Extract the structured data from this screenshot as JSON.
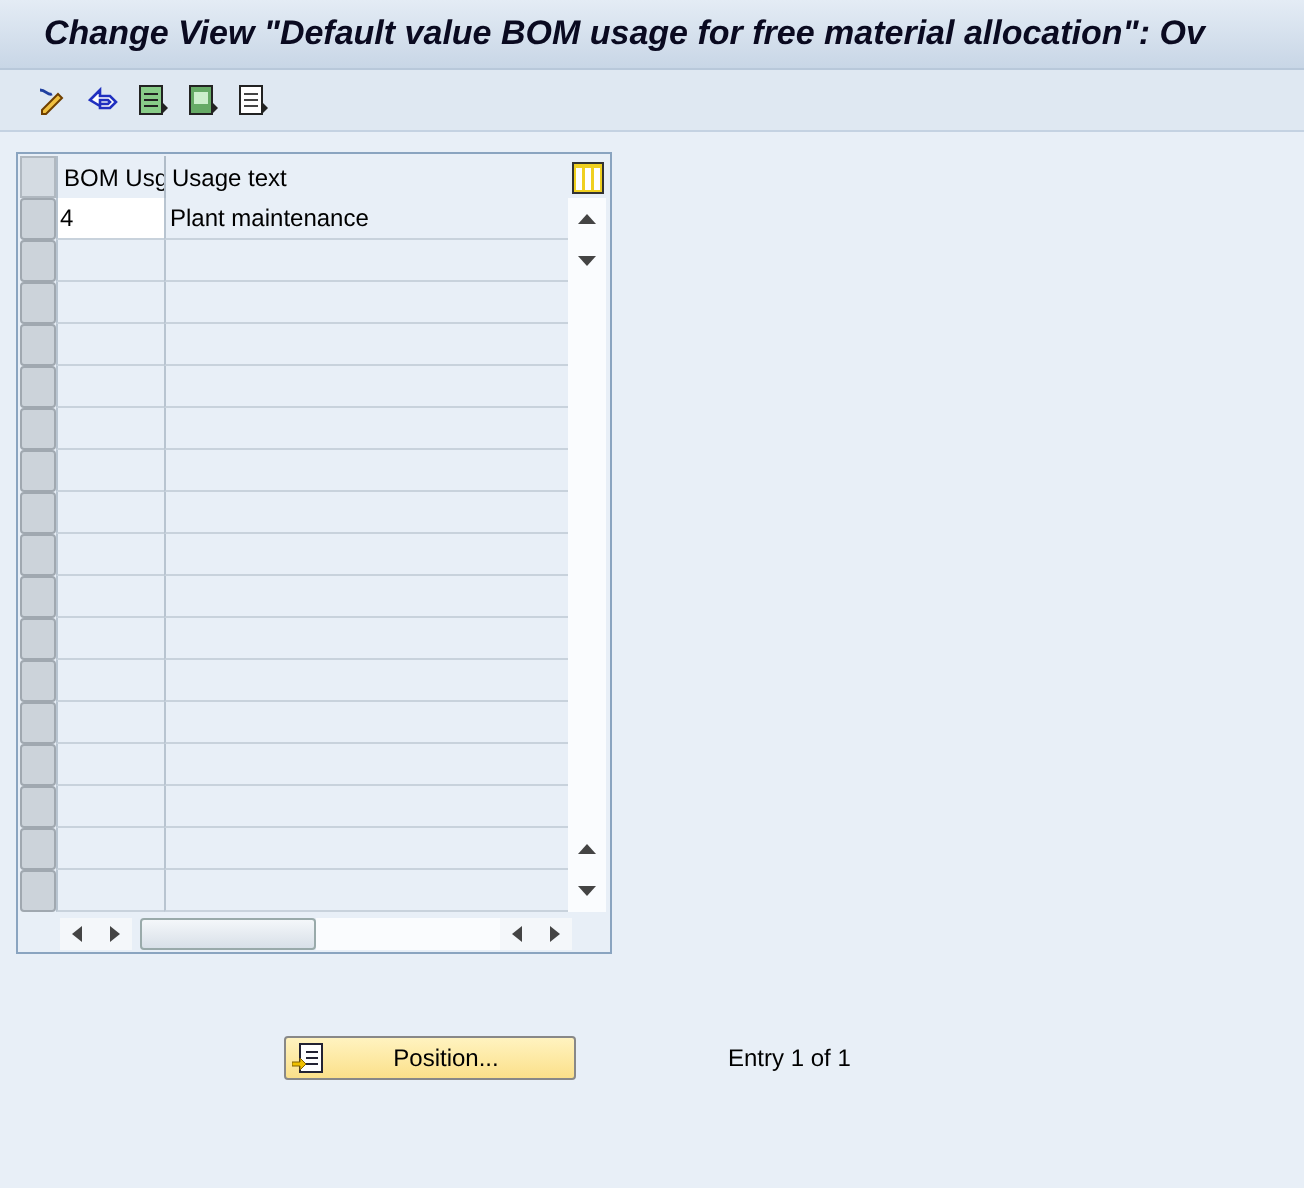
{
  "window": {
    "title": "Change View \"Default value BOM usage for free material allocation\": Ov"
  },
  "table": {
    "columns": [
      "BOM Usg",
      "Usage text"
    ],
    "rows": [
      {
        "bom_usg": "4",
        "usage_text": "Plant maintenance"
      }
    ]
  },
  "position_button": {
    "label": "Position..."
  },
  "entry_info": "Entry 1 of 1"
}
